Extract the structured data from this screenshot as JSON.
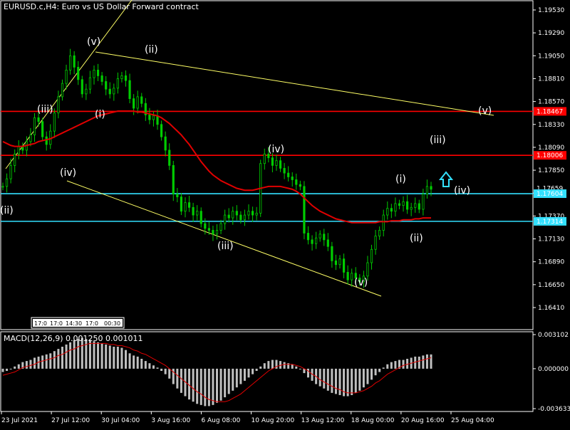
{
  "header": {
    "title": "EURUSD.c,H4:  Euro vs US Dollar Forward contract"
  },
  "macd": {
    "label": "MACD(12,26,9) 0.001250 0.001011"
  },
  "colors": {
    "background": "#000000",
    "candle": "#00cc00",
    "ma": "#e00000",
    "red_line": "#ff0000",
    "cyan_line": "#33e0ff",
    "trend": "#ffff66",
    "histogram": "#c0c0c0",
    "signal": "#e00000",
    "arrow": "#33e0ff"
  },
  "chart_data": [
    {
      "type": "candlestick",
      "y_ticks": [
        "1.19530",
        "1.19290",
        "1.19050",
        "1.18810",
        "1.18570",
        "1.18330",
        "1.18090",
        "1.17850",
        "1.17610",
        "1.17370",
        "1.17130",
        "1.16890",
        "1.16650",
        "1.16410"
      ],
      "ylim": [
        1.1628,
        1.1966
      ],
      "x_labels": [
        "23 Jul 2021",
        "27 Jul 12:00",
        "30 Jul 04:00",
        "3 Aug 16:00",
        "6 Aug 08:00",
        "10 Aug 20:00",
        "13 Aug 12:00",
        "18 Aug 00:00",
        "20 Aug 16:00",
        "25 Aug 04:00"
      ],
      "price_tags": [
        {
          "value": "1.18467",
          "color": "#ff0000",
          "price": 1.18467
        },
        {
          "value": "1.18006",
          "color": "#ff0000",
          "price": 1.18006
        },
        {
          "value": "1.17659",
          "color": "#000000",
          "price": 1.17659
        },
        {
          "value": "1.17604",
          "color": "#33e0ff",
          "price": 1.17604
        },
        {
          "value": "1.17314",
          "color": "#33e0ff",
          "price": 1.17314
        }
      ],
      "wave_labels": [
        "(ii)",
        "(iii)",
        "(iv)",
        "(v)",
        "(i)",
        "(ii)",
        "(iii)",
        "(iv)",
        "(v)",
        "(i)",
        "(ii)",
        "(iii)",
        "(iv)",
        "(v)"
      ],
      "date_box": [
        "17:0",
        "17:0",
        "14:30",
        "17:0",
        "00:30"
      ],
      "close": [
        1.1768,
        1.1776,
        1.179,
        1.1802,
        1.181,
        1.1806,
        1.1815,
        1.1822,
        1.184,
        1.1836,
        1.182,
        1.1812,
        1.1826,
        1.1845,
        1.1862,
        1.1876,
        1.189,
        1.1905,
        1.1893,
        1.188,
        1.1865,
        1.187,
        1.1882,
        1.189,
        1.1884,
        1.1878,
        1.187,
        1.1865,
        1.1871,
        1.1881,
        1.1884,
        1.1879,
        1.186,
        1.185,
        1.1862,
        1.1855,
        1.1843,
        1.1838,
        1.1842,
        1.1833,
        1.182,
        1.1806,
        1.179,
        1.176,
        1.1757,
        1.1742,
        1.1751,
        1.1746,
        1.1738,
        1.1742,
        1.1729,
        1.1724,
        1.1722,
        1.1718,
        1.1722,
        1.1729,
        1.1738,
        1.1735,
        1.1742,
        1.1738,
        1.1733,
        1.1738,
        1.1742,
        1.1738,
        1.174,
        1.1792,
        1.1802,
        1.1798,
        1.179,
        1.1795,
        1.1787,
        1.1782,
        1.1778,
        1.1775,
        1.177,
        1.1768,
        1.1719,
        1.1712,
        1.1708,
        1.1714,
        1.1718,
        1.1712,
        1.1705,
        1.169,
        1.1686,
        1.1692,
        1.1678,
        1.167,
        1.1677,
        1.1672,
        1.1668,
        1.1674,
        1.1688,
        1.1702,
        1.1716,
        1.1722,
        1.1738,
        1.1745,
        1.1742,
        1.175,
        1.1748,
        1.1752,
        1.1744,
        1.1746,
        1.175,
        1.1744,
        1.176,
        1.1768,
        1.1765
      ],
      "ma": [
        1.1815,
        1.1813,
        1.1811,
        1.181,
        1.181,
        1.181,
        1.1811,
        1.1812,
        1.1813,
        1.1815,
        1.1816,
        1.1817,
        1.1818,
        1.182,
        1.1822,
        1.1824,
        1.1826,
        1.1828,
        1.183,
        1.1832,
        1.1834,
        1.1836,
        1.1838,
        1.184,
        1.1842,
        1.1843,
        1.1844,
        1.1845,
        1.1846,
        1.1847,
        1.1847,
        1.1847,
        1.1847,
        1.1847,
        1.1846,
        1.1846,
        1.1845,
        1.1844,
        1.1843,
        1.1842,
        1.184,
        1.1837,
        1.1834,
        1.183,
        1.1826,
        1.1822,
        1.1817,
        1.1812,
        1.1806,
        1.18,
        1.1794,
        1.1789,
        1.1784,
        1.178,
        1.1777,
        1.1774,
        1.1772,
        1.177,
        1.1768,
        1.1766,
        1.1765,
        1.1764,
        1.1764,
        1.1764,
        1.1765,
        1.1766,
        1.1767,
        1.1768,
        1.1768,
        1.1768,
        1.1768,
        1.1767,
        1.1766,
        1.1765,
        1.1763,
        1.176,
        1.1756,
        1.1752,
        1.1748,
        1.1745,
        1.1742,
        1.174,
        1.1738,
        1.1736,
        1.1734,
        1.1733,
        1.1732,
        1.1731,
        1.173,
        1.173,
        1.173,
        1.173,
        1.173,
        1.173,
        1.173,
        1.1731,
        1.1731,
        1.1731,
        1.1732,
        1.1732,
        1.1732,
        1.1733,
        1.1733,
        1.1733,
        1.1734,
        1.1734,
        1.1735,
        1.1735,
        1.1735
      ]
    },
    {
      "type": "bar",
      "y_ticks": [
        "0.003102",
        "0.000000",
        "-0.003633"
      ],
      "ylim": [
        -0.003633,
        0.003102
      ],
      "histogram": [
        -0.0003,
        -0.0002,
        0.0,
        0.0002,
        0.0004,
        0.0006,
        0.0007,
        0.0008,
        0.001,
        0.0011,
        0.0012,
        0.0013,
        0.0014,
        0.0016,
        0.0018,
        0.002,
        0.0022,
        0.0024,
        0.0026,
        0.0027,
        0.0028,
        0.0027,
        0.0026,
        0.0025,
        0.0024,
        0.0023,
        0.0022,
        0.0021,
        0.002,
        0.002,
        0.0019,
        0.0017,
        0.0014,
        0.0012,
        0.0011,
        0.0009,
        0.0007,
        0.0005,
        0.0003,
        0.0001,
        -0.0002,
        -0.0005,
        -0.0009,
        -0.0014,
        -0.0018,
        -0.0022,
        -0.0025,
        -0.0028,
        -0.003,
        -0.0032,
        -0.0033,
        -0.0034,
        -0.0034,
        -0.0033,
        -0.0031,
        -0.0029,
        -0.0026,
        -0.0023,
        -0.002,
        -0.0017,
        -0.0014,
        -0.0011,
        -0.0008,
        -0.0005,
        -0.0002,
        0.0002,
        0.0005,
        0.0007,
        0.0008,
        0.0008,
        0.0007,
        0.0006,
        0.0005,
        0.0004,
        0.0002,
        0.0,
        -0.0004,
        -0.0008,
        -0.0011,
        -0.0014,
        -0.0016,
        -0.0018,
        -0.002,
        -0.0022,
        -0.0023,
        -0.0024,
        -0.0025,
        -0.0025,
        -0.0024,
        -0.0022,
        -0.002,
        -0.0017,
        -0.0014,
        -0.001,
        -0.0006,
        -0.0003,
        0.0001,
        0.0004,
        0.0006,
        0.0007,
        0.0008,
        0.0008,
        0.0009,
        0.001,
        0.0011,
        0.0011,
        0.0012,
        0.0013,
        0.0013
      ],
      "signal": [
        -0.0006,
        -0.0005,
        -0.0004,
        -0.0003,
        -0.0001,
        0.0001,
        0.0002,
        0.0003,
        0.0004,
        0.0006,
        0.0007,
        0.0008,
        0.0009,
        0.001,
        0.0012,
        0.0013,
        0.0015,
        0.0017,
        0.0018,
        0.002,
        0.0021,
        0.0022,
        0.0023,
        0.0023,
        0.0023,
        0.0023,
        0.0023,
        0.0022,
        0.0022,
        0.0021,
        0.0021,
        0.002,
        0.0019,
        0.0017,
        0.0016,
        0.0014,
        0.0013,
        0.0011,
        0.0009,
        0.0007,
        0.0005,
        0.0003,
        0.0,
        -0.0003,
        -0.0006,
        -0.0009,
        -0.0012,
        -0.0015,
        -0.0018,
        -0.0021,
        -0.0023,
        -0.0026,
        -0.0028,
        -0.0029,
        -0.003,
        -0.003,
        -0.003,
        -0.0029,
        -0.0027,
        -0.0025,
        -0.0023,
        -0.002,
        -0.0017,
        -0.0014,
        -0.0011,
        -0.0008,
        -0.0005,
        -0.0002,
        0.0,
        0.0002,
        0.0003,
        0.0004,
        0.0004,
        0.0004,
        0.0003,
        0.0002,
        0.0,
        -0.0002,
        -0.0005,
        -0.0007,
        -0.001,
        -0.0012,
        -0.0014,
        -0.0016,
        -0.0018,
        -0.0019,
        -0.0021,
        -0.0022,
        -0.0022,
        -0.0022,
        -0.0021,
        -0.002,
        -0.0018,
        -0.0016,
        -0.0013,
        -0.0011,
        -0.0008,
        -0.0005,
        -0.0003,
        -0.0001,
        0.0001,
        0.0003,
        0.0004,
        0.0005,
        0.0006,
        0.0007,
        0.0008,
        0.0009,
        0.001
      ]
    }
  ]
}
